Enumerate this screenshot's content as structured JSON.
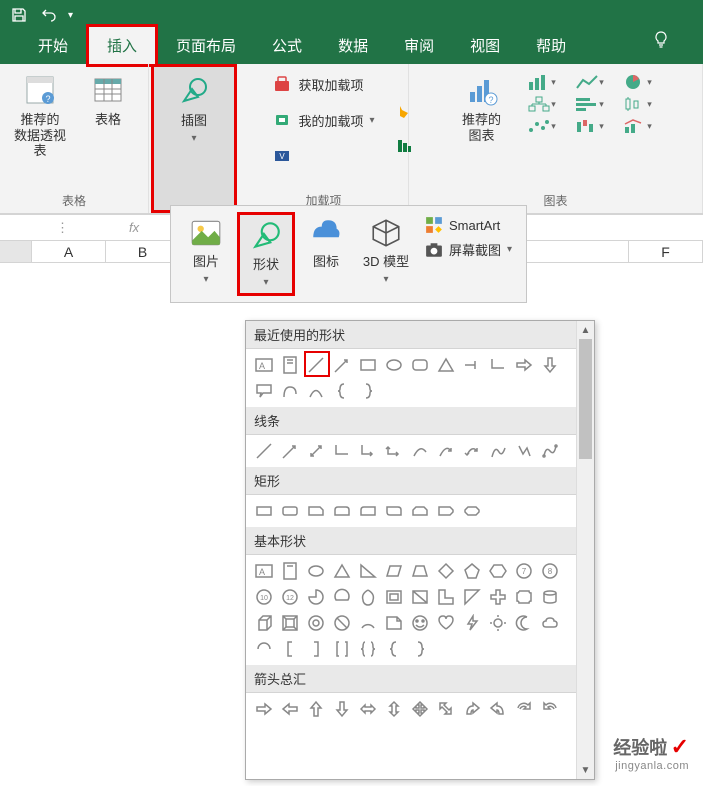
{
  "tabs": {
    "home": "开始",
    "insert": "插入",
    "pageLayout": "页面布局",
    "formulas": "公式",
    "data": "数据",
    "review": "审阅",
    "view": "视图",
    "help": "帮助"
  },
  "ribbon": {
    "pivotLabel": "推荐的\n数据透视表",
    "tableLabel": "表格",
    "tablesGroup": "表格",
    "illustrations": "插图",
    "getAddins": "获取加载项",
    "myAddins": "我的加载项",
    "addinsGroup": "加载项",
    "recCharts": "推荐的\n图表",
    "chartsGroup": "图表"
  },
  "sub": {
    "pictures": "图片",
    "shapes": "形状",
    "icons": "图标",
    "models": "3D 模型",
    "smartart": "SmartArt",
    "screenshot": "屏幕截图"
  },
  "grid": {
    "cols": [
      "A",
      "B",
      "F"
    ]
  },
  "shapesPanel": {
    "recent": "最近使用的形状",
    "lines": "线条",
    "rects": "矩形",
    "basic": "基本形状",
    "arrows": "箭头总汇"
  },
  "watermark": {
    "title": "经验啦",
    "sub": "jingyanla.com"
  }
}
